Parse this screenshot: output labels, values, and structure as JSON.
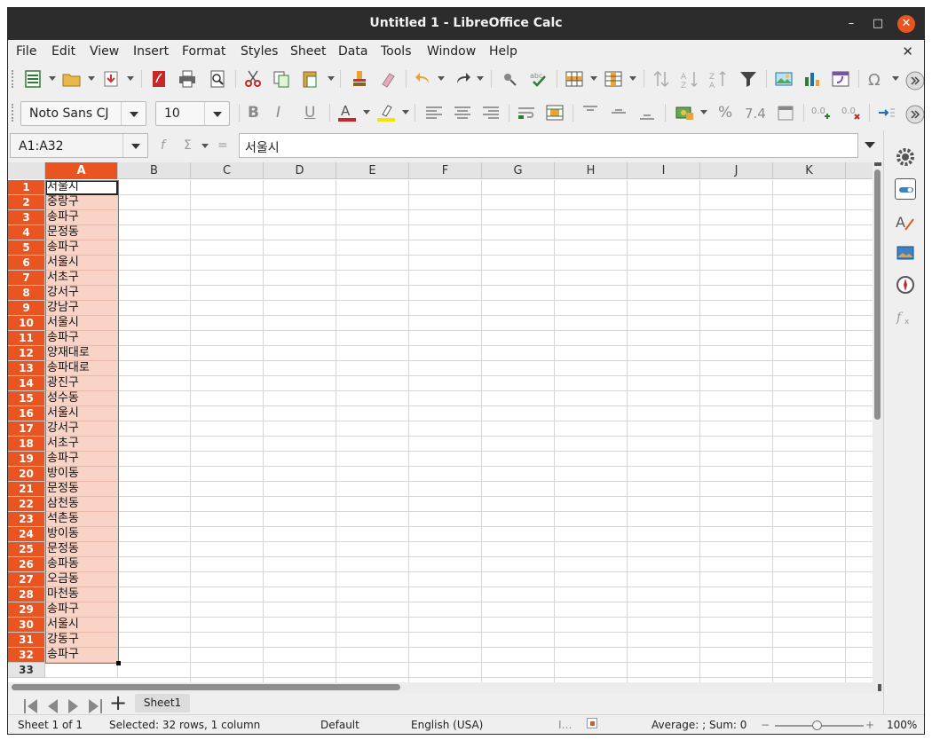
{
  "window": {
    "title": "Untitled 1 - LibreOffice Calc"
  },
  "menu": [
    "File",
    "Edit",
    "View",
    "Insert",
    "Format",
    "Styles",
    "Sheet",
    "Data",
    "Tools",
    "Window",
    "Help"
  ],
  "toolbar": {
    "font_name": "Noto Sans CJ",
    "font_size": "10",
    "currency_label": "%",
    "decimal_label": "7.4",
    "icons": [
      "new-icon",
      "open-icon",
      "save-icon",
      "export-pdf-icon",
      "print-icon",
      "print-preview-icon",
      "cut-icon",
      "copy-icon",
      "paste-icon",
      "clone-formatting-icon",
      "clear-formatting-icon",
      "undo-icon",
      "redo-icon",
      "find-replace-icon",
      "spelling-icon",
      "row-icon",
      "column-icon",
      "sort-icon",
      "sort-ascending-icon",
      "sort-descending-icon",
      "autofilter-icon",
      "image-icon",
      "chart-icon",
      "pivot-table-icon",
      "special-character-icon"
    ]
  },
  "formula_bar": {
    "name_box": "A1:A32",
    "fx_label": "f",
    "sigma_label": "Σ",
    "equals_label": "=",
    "content": "서울시"
  },
  "sheet": {
    "columns": [
      "A",
      "B",
      "C",
      "D",
      "E",
      "F",
      "G",
      "H",
      "I",
      "J",
      "K"
    ],
    "selected_column": "A",
    "rows": [
      {
        "n": "1",
        "a": "서울시"
      },
      {
        "n": "2",
        "a": "중랑구"
      },
      {
        "n": "3",
        "a": "송파구"
      },
      {
        "n": "4",
        "a": "문정동"
      },
      {
        "n": "5",
        "a": "송파구"
      },
      {
        "n": "6",
        "a": "서울시"
      },
      {
        "n": "7",
        "a": "서초구"
      },
      {
        "n": "8",
        "a": "강서구"
      },
      {
        "n": "9",
        "a": "강남구"
      },
      {
        "n": "10",
        "a": "서울시"
      },
      {
        "n": "11",
        "a": "송파구"
      },
      {
        "n": "12",
        "a": "양재대로"
      },
      {
        "n": "13",
        "a": "송파대로"
      },
      {
        "n": "14",
        "a": "광진구"
      },
      {
        "n": "15",
        "a": "성수동"
      },
      {
        "n": "16",
        "a": "서울시"
      },
      {
        "n": "17",
        "a": "강서구"
      },
      {
        "n": "18",
        "a": "서초구"
      },
      {
        "n": "19",
        "a": "송파구"
      },
      {
        "n": "20",
        "a": "방이동"
      },
      {
        "n": "21",
        "a": "문정동"
      },
      {
        "n": "22",
        "a": "삼천동"
      },
      {
        "n": "23",
        "a": "석촌동"
      },
      {
        "n": "24",
        "a": "방이동"
      },
      {
        "n": "25",
        "a": "문정동"
      },
      {
        "n": "26",
        "a": "송파동"
      },
      {
        "n": "27",
        "a": "오금동"
      },
      {
        "n": "28",
        "a": "마천동"
      },
      {
        "n": "29",
        "a": "송파구"
      },
      {
        "n": "30",
        "a": "서울시"
      },
      {
        "n": "31",
        "a": "강동구"
      },
      {
        "n": "32",
        "a": "송파구"
      },
      {
        "n": "33",
        "a": ""
      }
    ]
  },
  "sheet_tabs": [
    "Sheet1"
  ],
  "status": {
    "sheet_pos": "Sheet 1 of 1",
    "selection": "Selected: 32 rows, 1 column",
    "page_style": "Default",
    "language": "English (USA)",
    "summary": "Average: ; Sum: 0",
    "zoom": "100%",
    "zoom_minus": "−",
    "zoom_plus": "+"
  },
  "colors": {
    "accent": "#e95420",
    "selection_fill": "#f8d3c6",
    "titlebar": "#2c2c2c"
  }
}
